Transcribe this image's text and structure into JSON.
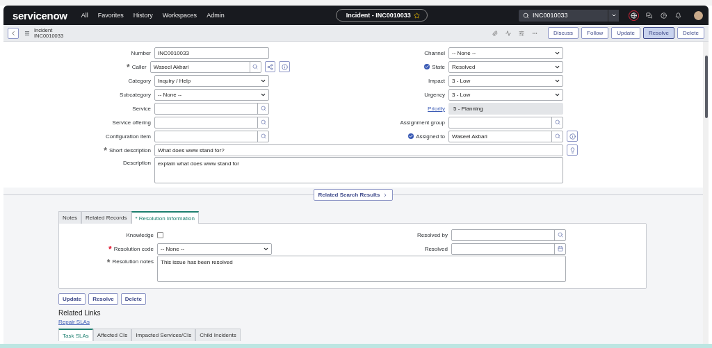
{
  "nav": {
    "logo": "servicenow",
    "items": [
      "All",
      "Favorites",
      "History",
      "Workspaces",
      "Admin"
    ],
    "record_pill": "Incident - INC0010033",
    "search": {
      "value": "INC0010033"
    }
  },
  "header": {
    "title": "Incident",
    "number": "INC0010033",
    "buttons": [
      {
        "label": "Discuss",
        "selected": false
      },
      {
        "label": "Follow",
        "selected": false
      },
      {
        "label": "Update",
        "selected": false
      },
      {
        "label": "Resolve",
        "selected": true
      },
      {
        "label": "Delete",
        "selected": false
      }
    ]
  },
  "form": {
    "left": [
      {
        "label": "Number",
        "kind": "text",
        "value": "INC0010033"
      },
      {
        "label": "Caller",
        "kind": "lookup",
        "value": "Waseel Akbari",
        "required_mark": "*",
        "extras": [
          {
            "kind": "share"
          },
          {
            "kind": "info"
          }
        ]
      },
      {
        "label": "Category",
        "kind": "select",
        "value": "Inquiry / Help"
      },
      {
        "label": "Subcategory",
        "kind": "select",
        "value": "-- None --"
      },
      {
        "label": "Service",
        "kind": "lookup"
      },
      {
        "label": "Service offering",
        "kind": "lookup"
      },
      {
        "label": "Configuration item",
        "kind": "lookup"
      }
    ],
    "right": [
      {
        "label": "Channel",
        "kind": "select",
        "value": "-- None --",
        "changed": false,
        "label_link": false
      },
      {
        "label": "State",
        "kind": "select",
        "value": "Resolved",
        "changed": true,
        "label_link": false
      },
      {
        "label": "Impact",
        "kind": "select",
        "value": "3 - Low",
        "changed": false,
        "label_link": false
      },
      {
        "label": "Urgency",
        "kind": "select",
        "value": "3 - Low",
        "changed": false,
        "label_link": false
      },
      {
        "label": "Priority",
        "kind": "readonly",
        "value": "5 - Planning",
        "changed": false,
        "label_link": true
      },
      {
        "label": "Assignment group",
        "kind": "lookup",
        "changed": false,
        "label_link": false
      },
      {
        "label": "Assigned to",
        "kind": "lookup",
        "value": "Waseel Akbari",
        "changed": true,
        "label_link": false,
        "extras": [
          {
            "kind": "info"
          }
        ]
      }
    ],
    "wide": [
      {
        "label": "Short description",
        "kind": "text",
        "value": "What does www stand for?",
        "required_mark": "*",
        "extras": [
          {
            "kind": "bulb"
          }
        ]
      },
      {
        "label": "Description",
        "kind": "textarea",
        "value": "explain what does www stand for"
      }
    ]
  },
  "related_search": "Related Search Results",
  "section_tabs": [
    {
      "label": "Notes",
      "selected": false
    },
    {
      "label": "Related Records",
      "selected": false
    },
    {
      "label": "* Resolution Information",
      "selected": true
    }
  ],
  "resolution": {
    "left": [
      {
        "label": "Knowledge",
        "kind": "checkbox",
        "checked": false
      },
      {
        "label": "Resolution code",
        "kind": "select",
        "value": "-- None --",
        "required_mark": "*",
        "missing": true
      }
    ],
    "right": [
      {
        "label": "Resolved by",
        "kind": "lookup"
      },
      {
        "label": "Resolved",
        "kind": "date"
      }
    ],
    "notes": {
      "label": "Resolution notes",
      "value": "This issue has been resolved",
      "required_mark": "*",
      "missing": false
    }
  },
  "bottom_buttons": [
    "Update",
    "Resolve",
    "Delete"
  ],
  "related_links": {
    "title": "Related Links",
    "links": [
      "Repair SLAs"
    ]
  },
  "list_tabs": [
    {
      "label": "Task SLAs",
      "selected": true
    },
    {
      "label": "Affected CIs",
      "selected": false
    },
    {
      "label": "Impacted Services/CIs",
      "selected": false
    },
    {
      "label": "Child Incidents",
      "selected": false
    }
  ]
}
